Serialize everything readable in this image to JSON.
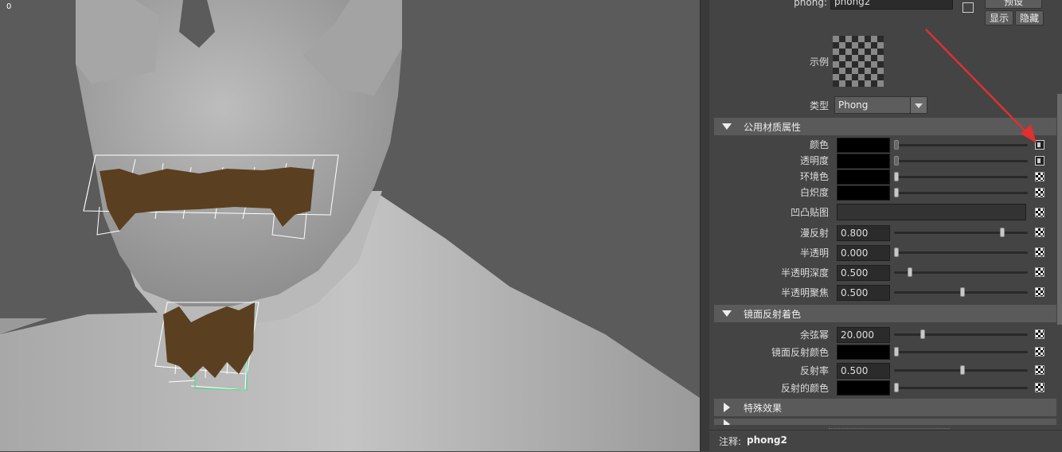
{
  "viewport": {
    "corner_label": "0"
  },
  "header": {
    "node_label": "phong:",
    "node_name": "phong2",
    "preset_label": "预设",
    "show_label": "显示",
    "hide_label": "隐藏"
  },
  "sample": {
    "label": "示例"
  },
  "type": {
    "label": "类型",
    "value": "Phong"
  },
  "sections": {
    "common": "公用材质属性",
    "specular": "镜面反射着色",
    "special": "特殊效果"
  },
  "attrs": {
    "color": "颜色",
    "transparency": "透明度",
    "ambient": "环境色",
    "incandescence": "白炽度",
    "bump": "凹凸贴图",
    "diffuse": {
      "label": "漫反射",
      "value": "0.800",
      "level": 0.8
    },
    "translucence": {
      "label": "半透明",
      "value": "0.000",
      "level": 0.0
    },
    "trans_depth": {
      "label": "半透明深度",
      "value": "0.500",
      "level": 0.1
    },
    "trans_focus": {
      "label": "半透明聚焦",
      "value": "0.500",
      "level": 0.5
    },
    "cosine_power": {
      "label": "余弦幂",
      "value": "20.000",
      "level": 0.2
    },
    "spec_color": "镜面反射颜色",
    "reflectivity": {
      "label": "反射率",
      "value": "0.500",
      "level": 0.5
    },
    "reflected_color": "反射的颜色"
  },
  "notes": {
    "label": "注释:",
    "value": "phong2"
  },
  "colors": {
    "annotation_arrow": "#e03030",
    "teeth": "#5a4020",
    "viewport_bg": "#5b5b5b"
  }
}
